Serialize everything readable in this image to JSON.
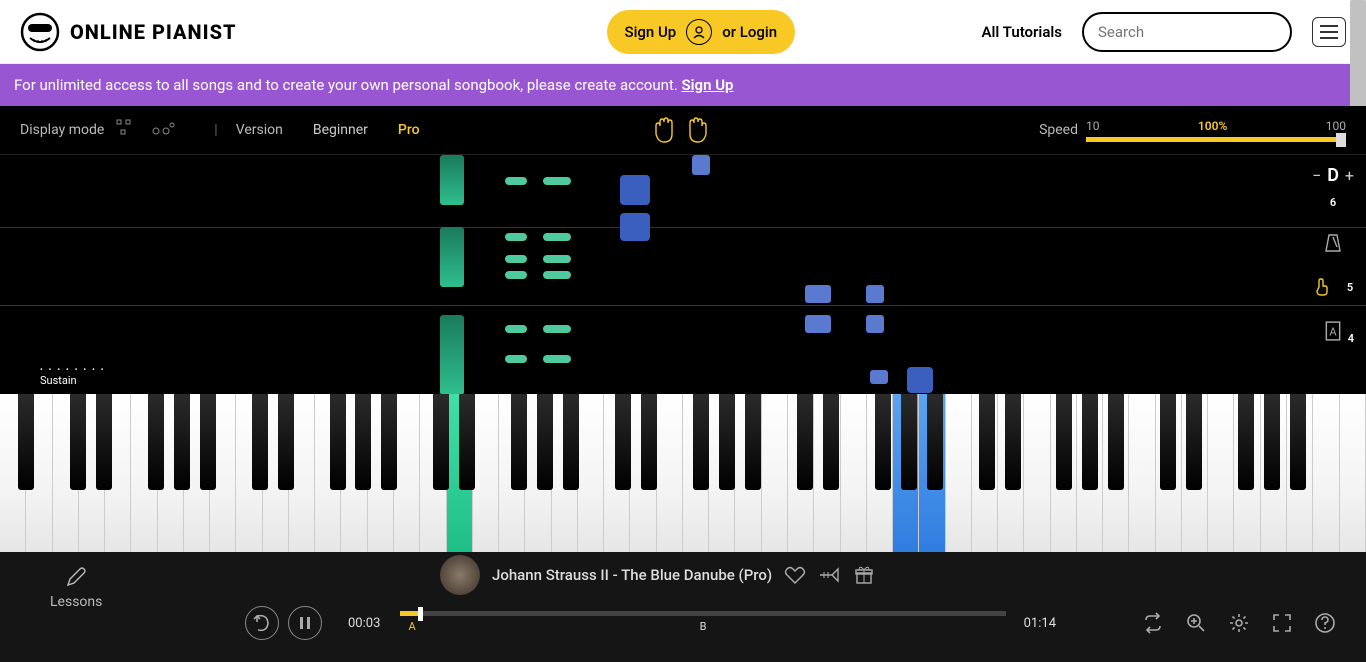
{
  "header": {
    "brand": "ONLINE PIANIST",
    "signup": "Sign Up",
    "or_login": "or Login",
    "all_tutorials": "All Tutorials",
    "search_placeholder": "Search"
  },
  "banner": {
    "text": "For unlimited access to all songs and to create your own personal songbook, please create account. ",
    "link": "Sign Up"
  },
  "controls": {
    "display_mode": "Display mode",
    "version": "Version",
    "beginner": "Beginner",
    "pro": "Pro",
    "speed_label": "Speed",
    "speed_min": "10",
    "speed_mid": "100%",
    "speed_max": "100"
  },
  "sustain": {
    "label": "Sustain"
  },
  "right_tools": {
    "key_minus": "−",
    "key_letter": "D",
    "key_plus": "+",
    "badge_top": "6",
    "badge_mid": "5",
    "badge_bot": "4",
    "letterA": "A"
  },
  "player": {
    "lessons": "Lessons",
    "title": "Johann Strauss II - The Blue Danube (Pro)",
    "time_cur": "00:03",
    "time_total": "01:14",
    "marker_a": "A",
    "marker_b": "B"
  }
}
